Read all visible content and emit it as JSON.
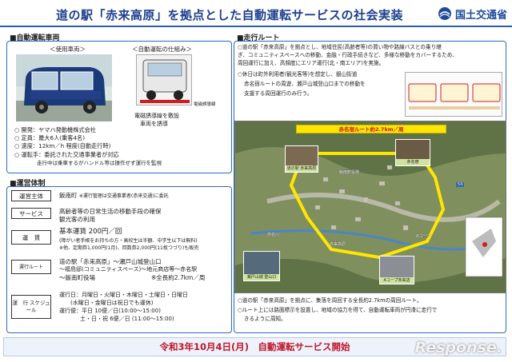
{
  "header": {
    "title": "道の駅「赤来高原」を拠点とした自動運転サービスの社会実装",
    "logo_text": "国土交通省"
  },
  "vehicle_section": {
    "title": "■自動運転車両",
    "used_vehicle_caption": "＜使用車両＞",
    "mechanism_caption": "＜自動運転の仕組み＞",
    "magnetic_label": "電磁誘導線",
    "mechanism_desc_1": "電磁誘導線を敷設",
    "mechanism_desc_2": "車両を誘導",
    "specs": [
      "○ 開発：ヤマハ発動機株式会社",
      "○ 定員：最大6人(乗客4名)",
      "○ 速度：12km／h 程度(自動走行時)",
      "○ 運転手：委託された交通事業者が対応"
    ],
    "spec_note": "走行中は乗車するがハンドル等は操作せず運行を監視"
  },
  "route_section": {
    "title": "■走行ルート",
    "desc_lines": [
      "○道の駅「赤来高原」を拠点とし、地域住民(高齢者等)の買い物や路線バスとの乗り継",
      "ぎ、コミュニティスペースへの移動、金融・行政手続きなど、多様な移動をカバーするため、",
      "周回運行に加え、高頻度にエリア運行(北・南エリア)を実施。",
      "○休日は町外利用者(観光客等)を想定し、銀山街道",
      "赤名宿ルートの周遊、瀬戸山城登山口までの移動を",
      "支援する周回運行のみ行う。"
    ],
    "route_banner": "赤名宿ルート約2.7km／周",
    "notes": [
      "○道の駅「赤来高原」を拠点に、集落を周回する全長約2.7kmの周回ルート。",
      "○ルート上には路面標示を設置し、地域の協力を得て、自動運転車両が円滑に走行で",
      "きるように周知。"
    ],
    "photo_labels": [
      "道の駅 赤来高原",
      "赤名宿",
      "瀬戸山城 登山口",
      "Aコープ赤来店"
    ],
    "map_labels": [
      "赤名川",
      "飯南町役場",
      "54",
      "赤来高原",
      "Aコープ"
    ]
  },
  "operation_section": {
    "title": "■運営体制",
    "rows": [
      {
        "label": "運営主体",
        "text": "飯南町",
        "note": "※運行管理は交通事業者(赤来交通)に委託"
      },
      {
        "label": "サービス",
        "text": "高齢者等の日常生活の移動手段の確保",
        "text2": "観光客の利用"
      },
      {
        "label": "運　賃",
        "text": "基本運賃 200円／回",
        "note": "(障がい者手帳をお持ちの方・高校生は半額、中学生以下は無料)",
        "note2": "※他、定期券1,000円(1月)、回数券2,000円(11枚つづり)も販売"
      },
      {
        "label": "運行ルート",
        "text": "道の駅「赤来高原」～瀬戸山城登山口",
        "text2": "～福島邸(コミュニティスペース)～地元商店等～赤名駅",
        "text3": "～飯南町役場",
        "text4": "※全長約2.7km／周"
      },
      {
        "label": "運　行 スケジュール",
        "text": "運行日：月曜日・火曜日・木曜日・土曜日・日曜日",
        "text2": "(水曜日・金曜日は祝日でも運休)",
        "text3": "運行便：平日 10便／日(10:00～15:00)",
        "text4": "土・日・祝 6便／日 (11:00～15:00)"
      }
    ]
  },
  "footer": {
    "banner": "令和3年10月4日(月)　自動運転サービス開始",
    "watermark": "Response."
  },
  "colors": {
    "title": "#1c3f8f",
    "panel_border": "#2a6bbf",
    "banner_text": "#c0142a",
    "route_yellow": "#ffe600"
  }
}
